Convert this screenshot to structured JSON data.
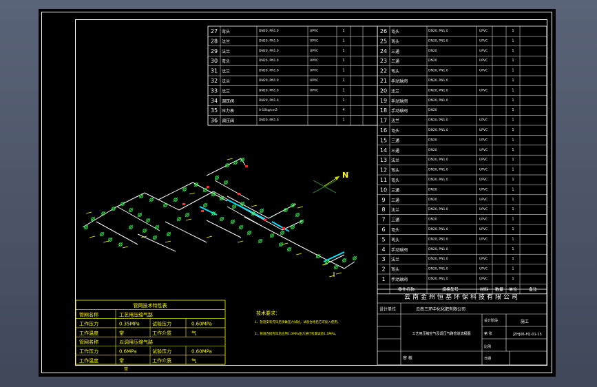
{
  "bom_left": [
    {
      "no": "27",
      "name": "弯头",
      "spec": "DN20, PN1.0",
      "mat": "UPVC",
      "qty": "1"
    },
    {
      "no": "28",
      "name": "法兰",
      "spec": "DN20, PN1.0",
      "mat": "UPVC",
      "qty": "1"
    },
    {
      "no": "29",
      "name": "法兰",
      "spec": "DN20, PN1.0",
      "mat": "UPVC",
      "qty": "1"
    },
    {
      "no": "30",
      "name": "弯头",
      "spec": "DN20, PN1.0",
      "mat": "UPVC",
      "qty": "1"
    },
    {
      "no": "31",
      "name": "法兰",
      "spec": "DN20, PN1.0",
      "mat": "UPVC",
      "qty": "1"
    },
    {
      "no": "32",
      "name": "法兰",
      "spec": "DN20, PN1.0",
      "mat": "UPVC",
      "qty": "1"
    },
    {
      "no": "33",
      "name": "法兰",
      "spec": "DN20, PN1.0",
      "mat": "UPVC",
      "qty": "1"
    },
    {
      "no": "34",
      "name": "调压阀",
      "spec": "DN20, PN1.0",
      "mat": "",
      "qty": "1"
    },
    {
      "no": "35",
      "name": "压力表",
      "spec": "0-10kg/cm2",
      "mat": "",
      "qty": "4"
    },
    {
      "no": "36",
      "name": "调压阀",
      "spec": "DN20, PN1.0",
      "mat": "",
      "qty": "1"
    }
  ],
  "bom_right": [
    {
      "no": "26",
      "name": "弯头",
      "spec": "DN20, PN1.0",
      "mat": "UPVC",
      "qty": "1"
    },
    {
      "no": "25",
      "name": "弯头",
      "spec": "DN20, PN1.0",
      "mat": "UPVC",
      "qty": "1"
    },
    {
      "no": "24",
      "name": "三通",
      "spec": "DN20",
      "mat": "UPVC",
      "qty": "1"
    },
    {
      "no": "23",
      "name": "三通",
      "spec": "DN20",
      "mat": "UPVC",
      "qty": "1"
    },
    {
      "no": "22",
      "name": "弯头",
      "spec": "DN20, PN1.0",
      "mat": "UPVC",
      "qty": "1"
    },
    {
      "no": "21",
      "name": "手动球阀",
      "spec": "DN20, PN1.0",
      "mat": "",
      "qty": "1"
    },
    {
      "no": "20",
      "name": "法兰",
      "spec": "DN20, PN1.0",
      "mat": "UPVC",
      "qty": "1"
    },
    {
      "no": "19",
      "name": "手动球阀",
      "spec": "DN20, PN1.0",
      "mat": "",
      "qty": "1"
    },
    {
      "no": "18",
      "name": "手动球阀",
      "spec": "DN20",
      "mat": "",
      "qty": "1"
    },
    {
      "no": "17",
      "name": "法兰",
      "spec": "DN20, PN1.0",
      "mat": "UPVC",
      "qty": "1"
    },
    {
      "no": "16",
      "name": "弯头",
      "spec": "DN20, PN1.0",
      "mat": "UPVC",
      "qty": "1"
    },
    {
      "no": "15",
      "name": "三通",
      "spec": "DN20",
      "mat": "UPVC",
      "qty": "1"
    },
    {
      "no": "14",
      "name": "三通",
      "spec": "DN20",
      "mat": "UPVC",
      "qty": "1"
    },
    {
      "no": "13",
      "name": "法兰",
      "spec": "DN20, PN1.0",
      "mat": "UPVC",
      "qty": "1"
    },
    {
      "no": "12",
      "name": "弯头",
      "spec": "DN20, PN1.0",
      "mat": "UPVC",
      "qty": "1"
    },
    {
      "no": "11",
      "name": "弯头",
      "spec": "DN20, PN1.0",
      "mat": "UPVC",
      "qty": "1"
    },
    {
      "no": "10",
      "name": "三通",
      "spec": "DN20",
      "mat": "UPVC",
      "qty": "1"
    },
    {
      "no": "9",
      "name": "三通",
      "spec": "DN20",
      "mat": "UPVC",
      "qty": "1"
    },
    {
      "no": "8",
      "name": "法兰",
      "spec": "DN20, PN1.0",
      "mat": "UPVC",
      "qty": "1"
    },
    {
      "no": "7",
      "name": "三通",
      "spec": "DN20",
      "mat": "UPVC",
      "qty": "1"
    },
    {
      "no": "6",
      "name": "弯头",
      "spec": "DN20, PN1.0",
      "mat": "UPVC",
      "qty": "1"
    },
    {
      "no": "5",
      "name": "弯头",
      "spec": "DN20, PN1.0",
      "mat": "UPVC",
      "qty": "1"
    },
    {
      "no": "4",
      "name": "手动球阀",
      "spec": "DN20, PN1.0",
      "mat": "",
      "qty": "1"
    },
    {
      "no": "3",
      "name": "法兰",
      "spec": "DN20, PN1.0",
      "mat": "UPVC",
      "qty": "1"
    },
    {
      "no": "2",
      "name": "弯头",
      "spec": "DN20, PN1.0",
      "mat": "UPVC",
      "qty": "1"
    },
    {
      "no": "1",
      "name": "手动球阀",
      "spec": "DN20, PN1.0",
      "mat": "UPVC",
      "qty": "1"
    }
  ],
  "bom_header": {
    "name": "零件名称",
    "spec": "规格型号",
    "mat": "材料",
    "qty": "数量",
    "unit": "单位",
    "remark": "备注"
  },
  "title_block": {
    "company": "云南金州恒基环保科技有限公司",
    "design_unit_label": "设计单位",
    "client": "云南三环中化化肥有限公司",
    "drawing_title": "工艺用压缩空气及调压气路管道流程图",
    "stage_label": "设计阶段",
    "stage": "施工",
    "drawing_no": "JZHJ06-FQ-01-15",
    "scale": "比例",
    "sheet": "第 张",
    "date": "日期",
    "approved": "审 核"
  },
  "north_label": "N",
  "tech_notes": {
    "title": "技术要求：",
    "line1": "1、管道安装完毕后须做压力试验，试验合格后方可投入使用。",
    "line2": "2、管道连接完毕后应用1.0MPa压力进行检漏试验1.0MPa。"
  },
  "pipe_table": {
    "title": "管网技术特性表",
    "rows": [
      [
        "管网名称",
        "工艺用压缩气路",
        "",
        ""
      ],
      [
        "工作压力",
        "0.35MPa",
        "试验压力",
        "0.60MPa"
      ],
      [
        "工作温度",
        "常",
        "工作介质",
        "气"
      ],
      [
        "管网名称",
        "以调用压缩气路",
        "",
        ""
      ],
      [
        "工作压力",
        "0.6MPa",
        "试验压力",
        "0.60MPa"
      ],
      [
        "工作温度",
        "常",
        "工作介质",
        "气"
      ]
    ],
    "footer": "常"
  }
}
